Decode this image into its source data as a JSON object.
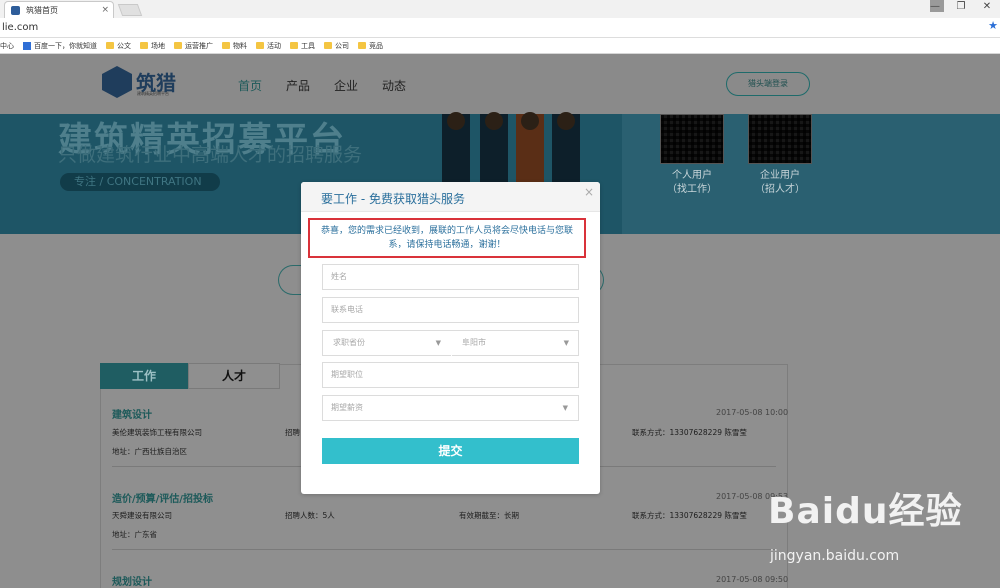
{
  "browser": {
    "tab_title": "筑猎首页",
    "tab_close": "×",
    "address": "lie.com",
    "window_controls": [
      "—",
      "❐",
      "✕"
    ],
    "bookmarks": [
      {
        "label": "中心",
        "icon": "none"
      },
      {
        "label": "百度一下，你就知道",
        "icon": "baidu-icon"
      },
      {
        "label": "公文",
        "icon": "folder-icon"
      },
      {
        "label": "场地",
        "icon": "folder-icon"
      },
      {
        "label": "运营推广",
        "icon": "folder-icon"
      },
      {
        "label": "物料",
        "icon": "folder-icon"
      },
      {
        "label": "活动",
        "icon": "folder-icon"
      },
      {
        "label": "工具",
        "icon": "folder-icon"
      },
      {
        "label": "公司",
        "icon": "folder-icon"
      },
      {
        "label": "竞品",
        "icon": "folder-icon"
      }
    ]
  },
  "site": {
    "logo_text": "筑猎",
    "logo_sub": "建筑精英招聘平台",
    "nav": [
      "首页",
      "产品",
      "企业",
      "动态"
    ],
    "login_label": "猎头端登录",
    "banner_title": "建筑精英招募平台",
    "banner_sub": "只做建筑行业中高端人才的招聘服务",
    "banner_pill": "专注 / CONCENTRATION",
    "qr_personal": "个人用户\n（找工作）",
    "qr_enterprise": "企业用户\n（招人才）"
  },
  "listing": {
    "tabs": [
      "工作",
      "人才"
    ],
    "jobs": [
      {
        "title": "建筑设计",
        "date": "2017-05-08 10:00",
        "company": "美伦建筑装饰工程有限公司",
        "recruit": "招聘",
        "validity": "",
        "contact": "联系方式：13307628229 陈雪莹",
        "address": "地址：广西壮族自治区"
      },
      {
        "title": "造价/预算/评估/招投标",
        "date": "2017-05-08 09:53",
        "company": "天舜建设有限公司",
        "recruit": "招聘人数：5人",
        "validity": "有效期截至：长期",
        "contact": "联系方式：13307628229 陈雪莹",
        "address": "地址：广东省"
      },
      {
        "title": "规划设计",
        "date": "2017-05-08 09:50",
        "company": "",
        "recruit": "",
        "validity": "",
        "contact": "",
        "address": ""
      }
    ]
  },
  "modal": {
    "title": "要工作 - 免费获取猎头服务",
    "close": "×",
    "notice": "恭喜，您的需求已经收到，展联的工作人员将会尽快电话与您联系，请保持电话畅通，谢谢！",
    "name_placeholder": "姓名",
    "phone_placeholder": "联系电话",
    "province_placeholder": "求职省份",
    "city_value": "阜阳市",
    "position_placeholder": "期望职位",
    "salary_placeholder": "期望薪资",
    "submit_label": "提交"
  },
  "watermark": {
    "brand": "Baidu经验",
    "url": "jingyan.baidu.com"
  }
}
